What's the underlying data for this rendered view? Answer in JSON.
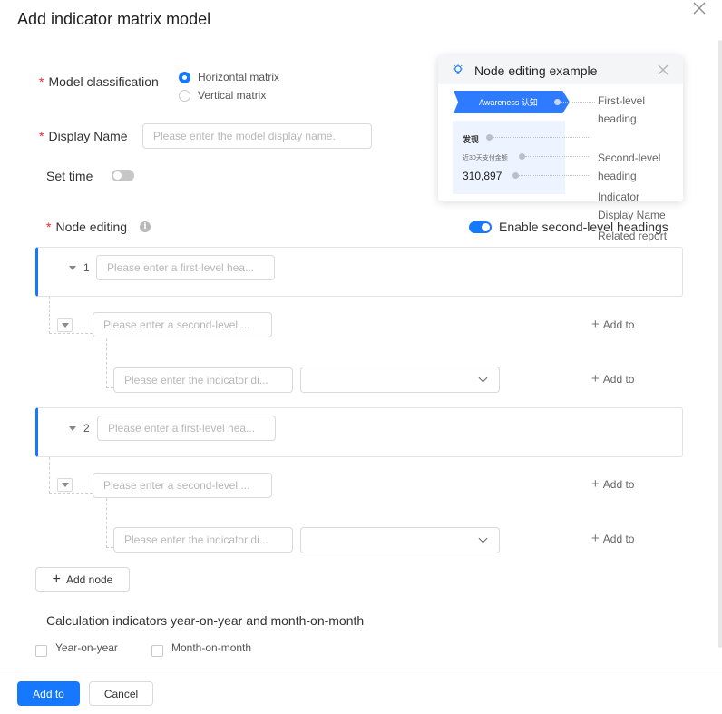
{
  "dialog": {
    "title": "Add indicator matrix model"
  },
  "form": {
    "required_mark": "*",
    "model_classification": {
      "label": "Model classification",
      "options": [
        "Horizontal matrix",
        "Vertical matrix"
      ],
      "selected": "Horizontal matrix"
    },
    "display_name": {
      "label": "Display Name",
      "placeholder": "Please enter the model display name."
    },
    "set_time": {
      "label": "Set time",
      "enabled": false
    },
    "node_editing": {
      "label": "Node editing",
      "enable_second_level_label": "Enable second-level headings",
      "enable_second_level": true
    }
  },
  "nodes": [
    {
      "number": "1",
      "first_level_placeholder": "Please enter a first-level hea...",
      "second_level_placeholder": "Please enter a second-level ...",
      "indicator_placeholder": "Please enter the indicator di...",
      "add_to_label": "Add to"
    },
    {
      "number": "2",
      "first_level_placeholder": "Please enter a first-level hea...",
      "second_level_placeholder": "Please enter a second-level ...",
      "indicator_placeholder": "Please enter the indicator di...",
      "add_to_label": "Add to"
    }
  ],
  "add_node_label": "Add node",
  "calculation": {
    "label": "Calculation indicators year-on-year and month-on-month",
    "options": [
      "Year-on-year",
      "Month-on-month"
    ]
  },
  "footer": {
    "confirm_label": "Add to",
    "cancel_label": "Cancel"
  },
  "example_popover": {
    "title": "Node editing example",
    "flag_text": "Awareness 认知",
    "card_title": "发现",
    "card_metric_name": "近30天支付金额",
    "card_value": "310,897",
    "labels": {
      "first_level": "First-level\nheading",
      "second_level": "Second-level\nheading",
      "indicator": "Indicator",
      "display_name": "Display Name",
      "related_report": "Related report"
    }
  },
  "colors": {
    "primary": "#1677ff",
    "required": "#f5222d"
  },
  "icons": {
    "close": "close-icon",
    "info": "info-icon",
    "bulb": "lightbulb-icon",
    "plus": "plus-icon",
    "caret": "caret-down-icon",
    "chevron": "chevron-down-icon"
  }
}
